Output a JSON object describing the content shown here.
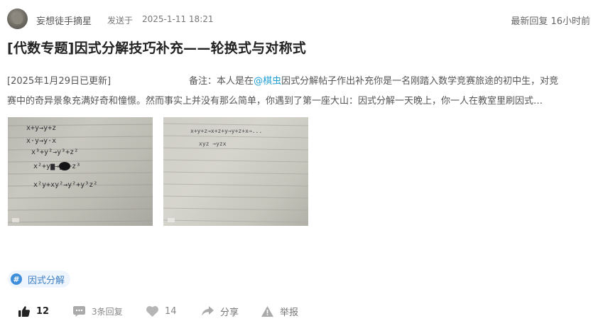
{
  "header": {
    "author": "妄想徒手摘星",
    "action": "发送于",
    "time": "2025-1-11 18:21",
    "latest_reply": "最新回复 16小时前"
  },
  "post": {
    "title": "[代数专题]因式分解技巧补充——轮换式与对称式",
    "updated": "[2025年1月29日已更新]",
    "note_prefix": "备注：本人是在",
    "mention": "@棋虫",
    "line1_rest": "因式分解帖子作出补充你是一名刚踏入数学竞赛旅途的初中生，对竞",
    "line2": "赛中的奇异景象充满好奇和憧憬。然而事实上并没有那么简单，你遇到了第一座大山：因式分解一天晚上，你一人在教室里刷因式…"
  },
  "images": [
    {
      "name": "handwritten-notes-image-1",
      "lines": [
        "x+y→y+z",
        "x·y→y·x",
        "x³+y²→y³+z²",
        "x²+y▆→y³+z³",
        "x²y+xy²→y²+y³z²"
      ]
    },
    {
      "name": "handwritten-notes-image-2",
      "lines": [
        "x+y+z→x+z+y→y+z+x→...",
        "xyz →yzx"
      ]
    }
  ],
  "tag": {
    "icon": "hash-icon",
    "label": "因式分解"
  },
  "actions": {
    "like": {
      "icon": "thumbs-up-icon",
      "count": "12"
    },
    "reply": {
      "icon": "comment-icon",
      "label": "3条回复"
    },
    "favorite": {
      "icon": "heart-icon",
      "count": "14"
    },
    "share": {
      "icon": "share-icon",
      "label": "分享"
    },
    "report": {
      "icon": "warning-icon",
      "label": "举报"
    }
  }
}
